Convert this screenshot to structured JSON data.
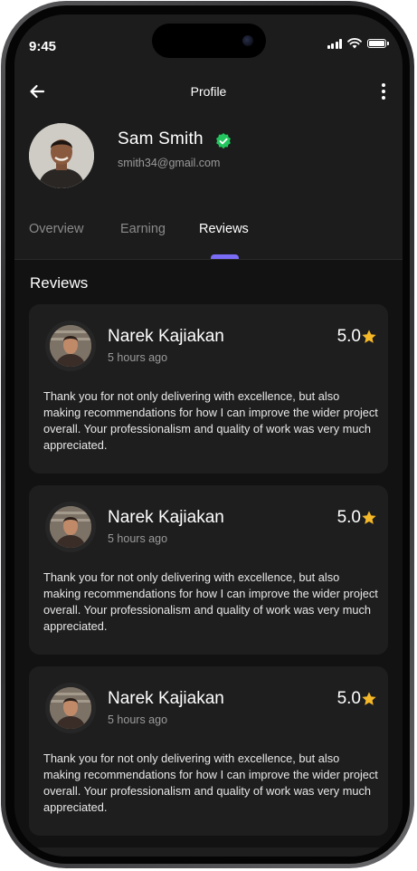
{
  "status_bar": {
    "time": "9:45"
  },
  "header": {
    "title": "Profile"
  },
  "profile": {
    "name": "Sam Smith",
    "email": "smith34@gmail.com",
    "verified": true
  },
  "tabs": [
    {
      "label": "Overview",
      "active": false
    },
    {
      "label": "Earning",
      "active": false
    },
    {
      "label": "Reviews",
      "active": true
    }
  ],
  "reviews_section": {
    "title": "Reviews"
  },
  "reviews": [
    {
      "name": "Narek Kajiakan",
      "time": "5 hours ago",
      "rating": "5.0",
      "text": "Thank you for not only delivering with excellence, but also making recommendations for how I can improve the wider project overall. Your professionalism and quality of work was very much appreciated."
    },
    {
      "name": "Narek Kajiakan",
      "time": "5 hours ago",
      "rating": "5.0",
      "text": "Thank you for not only delivering with excellence, but also making recommendations for how I can improve the wider project overall. Your professionalism and quality of work was very much appreciated."
    },
    {
      "name": "Narek Kajiakan",
      "time": "5 hours ago",
      "rating": "5.0",
      "text": "Thank you for not only delivering with excellence, but also making recommendations for how I can improve the wider project overall. Your professionalism and quality of work was very much appreciated."
    }
  ],
  "colors": {
    "accent": "#7b6cf6",
    "verified": "#22c55e",
    "star": "#f5b829",
    "background": "#121212",
    "card": "#1e1e1e"
  }
}
